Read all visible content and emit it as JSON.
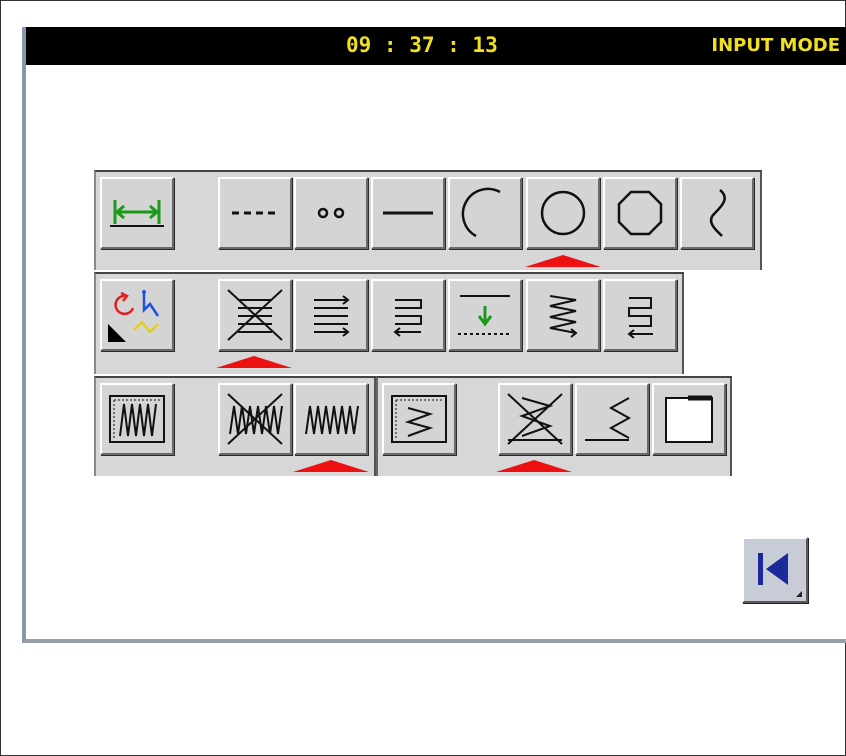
{
  "status_bar": {
    "clock": "09 : 37 : 13",
    "mode": "INPUT MODE"
  },
  "colors": {
    "status_text": "#f0e020",
    "selected_marker": "#ee1111",
    "panel": "#d7d7d7",
    "icon_green": "#1a9a1a"
  },
  "rows": [
    {
      "name": "line-type",
      "buttons": [
        "dimension-icon",
        "dashed-line-icon",
        "dots-icon",
        "solid-line-icon",
        "arc-icon",
        "circle-icon",
        "octagon-icon",
        "curve-icon"
      ],
      "selected": "circle-icon"
    },
    {
      "name": "stitch-pattern",
      "buttons": [
        "sequence-mode-icon",
        "zigzag-off-icon",
        "multi-line-right-icon",
        "back-tack-icon",
        "start-point-icon",
        "zigzag-right-icon",
        "back-tack-return-icon"
      ],
      "selected": "zigzag-off-icon"
    },
    {
      "name": "zigzag-group",
      "buttons": [
        "zigzag-settings-icon",
        "zigzag-off-icon",
        "zigzag-on-icon",
        "zigzag-width-settings-icon",
        "zigzag-width-off-icon",
        "zigzag-width-step-icon",
        "blank-frame-icon"
      ],
      "selected": [
        "zigzag-on-icon",
        "zigzag-width-off-icon"
      ]
    }
  ],
  "navigation": {
    "back_icon": "skip-back-icon"
  }
}
